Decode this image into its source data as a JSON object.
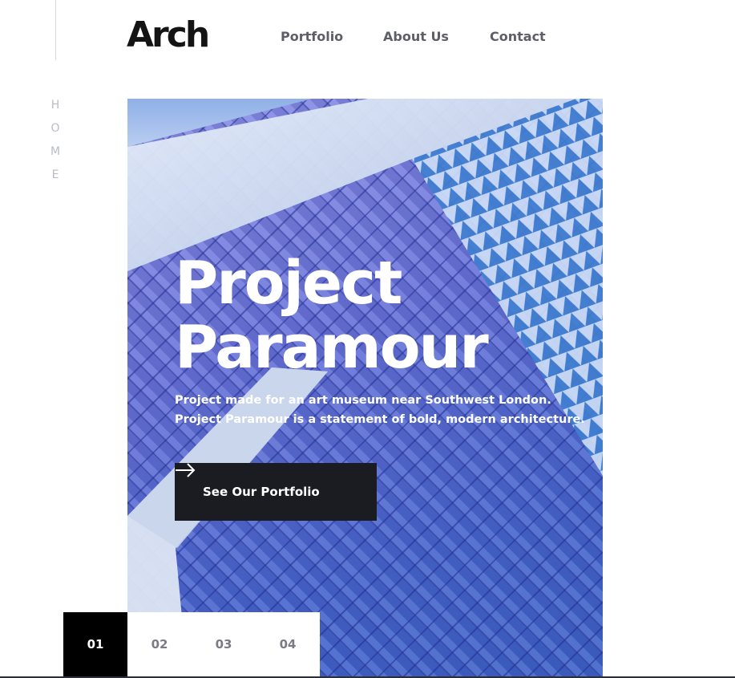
{
  "brand": {
    "logo": "Arch"
  },
  "nav": {
    "items": [
      {
        "label": "Portfolio"
      },
      {
        "label": "About Us"
      },
      {
        "label": "Contact"
      }
    ]
  },
  "side_label": {
    "letters": [
      "H",
      "O",
      "M",
      "E"
    ]
  },
  "hero": {
    "title_line1": "Project",
    "title_line2": "Paramour",
    "description_line1": "Project made for an art museum near Southwest London.",
    "description_line2": "Project Paramour is a statement of bold, modern architecture.",
    "cta_label": "See Our Portfolio",
    "cta_icon": "arrow-right-icon"
  },
  "pager": {
    "items": [
      "01",
      "02",
      "03",
      "04"
    ],
    "active": "01"
  },
  "colors": {
    "text_dark": "#141414",
    "nav_gray": "#5d5e68",
    "cta_bg": "#1b1c22",
    "pager_active": "#000000"
  }
}
